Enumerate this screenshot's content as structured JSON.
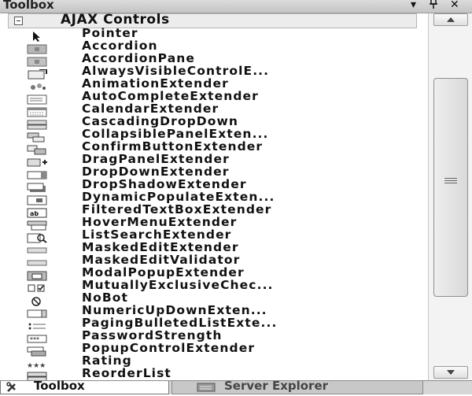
{
  "window": {
    "title": "Toolbox"
  },
  "group": {
    "title": "AJAX Controls"
  },
  "items": [
    {
      "label": "Pointer",
      "icon": "pointer-icon"
    },
    {
      "label": "Accordion",
      "icon": "accordion-icon"
    },
    {
      "label": "AccordionPane",
      "icon": "accordion-pane-icon"
    },
    {
      "label": "AlwaysVisibleControlE...",
      "icon": "always-visible-icon"
    },
    {
      "label": "AnimationExtender",
      "icon": "animation-icon"
    },
    {
      "label": "AutoCompleteExtender",
      "icon": "autocomplete-icon"
    },
    {
      "label": "CalendarExtender",
      "icon": "calendar-icon"
    },
    {
      "label": "CascadingDropDown",
      "icon": "cascading-dropdown-icon"
    },
    {
      "label": "CollapsiblePanelExten...",
      "icon": "collapsible-panel-icon"
    },
    {
      "label": "ConfirmButtonExtender",
      "icon": "confirm-button-icon"
    },
    {
      "label": "DragPanelExtender",
      "icon": "drag-panel-icon"
    },
    {
      "label": "DropDownExtender",
      "icon": "dropdown-icon"
    },
    {
      "label": "DropShadowExtender",
      "icon": "drop-shadow-icon"
    },
    {
      "label": "DynamicPopulateExten...",
      "icon": "dynamic-populate-icon"
    },
    {
      "label": "FilteredTextBoxExtender",
      "icon": "filtered-textbox-icon"
    },
    {
      "label": "HoverMenuExtender",
      "icon": "hover-menu-icon"
    },
    {
      "label": "ListSearchExtender",
      "icon": "list-search-icon"
    },
    {
      "label": "MaskedEditExtender",
      "icon": "masked-edit-icon"
    },
    {
      "label": "MaskedEditValidator",
      "icon": "masked-validator-icon"
    },
    {
      "label": "ModalPopupExtender",
      "icon": "modal-popup-icon"
    },
    {
      "label": "MutuallyExclusiveChec...",
      "icon": "mutually-exclusive-icon"
    },
    {
      "label": "NoBot",
      "icon": "nobot-icon"
    },
    {
      "label": "NumericUpDownExten...",
      "icon": "numeric-updown-icon"
    },
    {
      "label": "PagingBulletedListExte...",
      "icon": "paging-bulleted-icon"
    },
    {
      "label": "PasswordStrength",
      "icon": "password-strength-icon"
    },
    {
      "label": "PopupControlExtender",
      "icon": "popup-control-icon"
    },
    {
      "label": "Rating",
      "icon": "rating-icon"
    },
    {
      "label": "ReorderList",
      "icon": "reorder-list-icon"
    }
  ],
  "tabs": [
    {
      "label": "Toolbox",
      "icon": "toolbox-icon",
      "active": true
    },
    {
      "label": "Server Explorer",
      "icon": "server-explorer-icon",
      "active": false
    }
  ]
}
